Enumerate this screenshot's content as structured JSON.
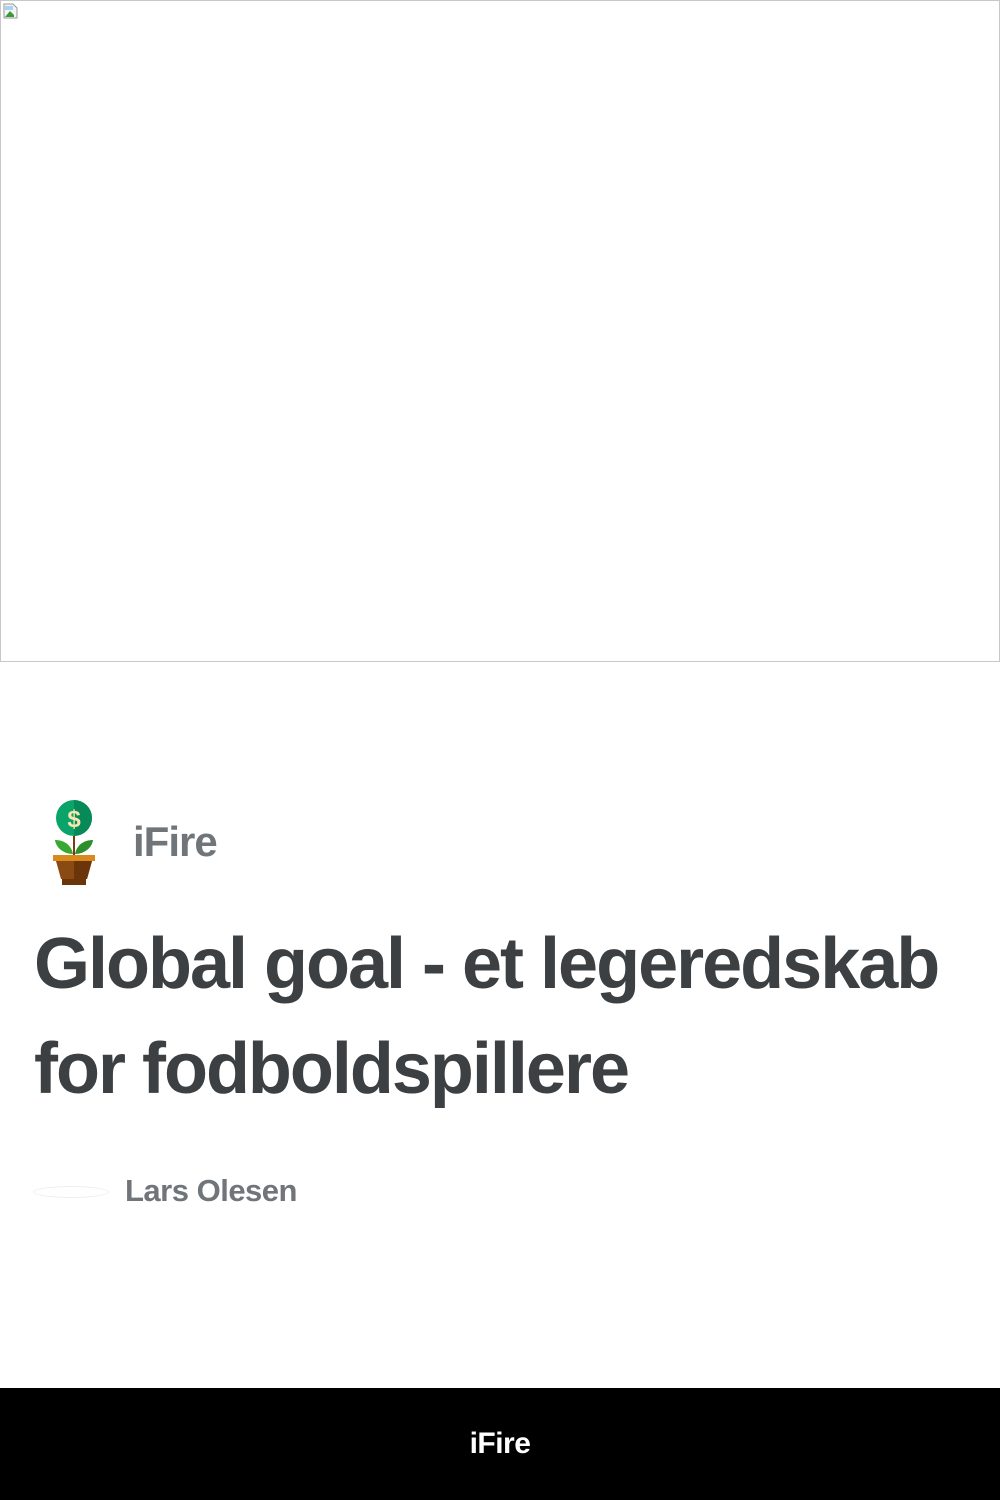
{
  "hero": {
    "icon": "broken-image-icon"
  },
  "brand": {
    "name": "iFire",
    "logo_icon": "money-plant-icon"
  },
  "article": {
    "title": "Global goal - et legeredskab for fodboldspillere",
    "author": "Lars Olesen"
  },
  "footer": {
    "label": "iFire"
  },
  "colors": {
    "title": "#3c4043",
    "muted": "#70757a",
    "footer_bg": "#000000"
  }
}
